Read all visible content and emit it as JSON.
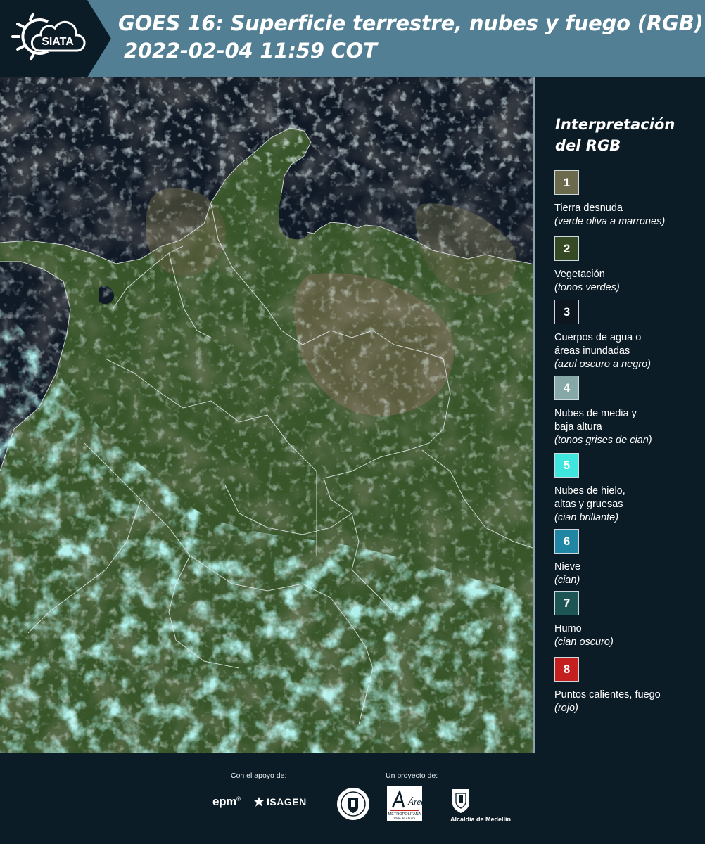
{
  "header": {
    "logo_text": "SIATA",
    "title_line1": "GOES 16: Superficie terrestre, nubes y fuego (RGB)",
    "title_line2": "2022-02-04 11:59 COT"
  },
  "legend": {
    "title_line1": "Interpretación",
    "title_line2": "del RGB",
    "items": [
      {
        "number": "1",
        "color": "#6b6a4c",
        "label_lines": [
          "Tierra desnuda"
        ],
        "note": "(verde oliva a marrones)"
      },
      {
        "number": "2",
        "color": "#354a24",
        "label_lines": [
          "Vegetación"
        ],
        "note": "(tonos verdes)"
      },
      {
        "number": "3",
        "color": "#0e1720",
        "label_lines": [
          "Cuerpos de agua o",
          "áreas inundadas"
        ],
        "note": "(azul oscuro a negro)"
      },
      {
        "number": "4",
        "color": "#86a9a8",
        "label_lines": [
          "Nubes de media y",
          "baja altura"
        ],
        "note": "(tonos grises de cian)"
      },
      {
        "number": "5",
        "color": "#3ee6de",
        "label_lines": [
          "Nubes de hielo,",
          "altas y gruesas"
        ],
        "note": "(cian brillante)"
      },
      {
        "number": "6",
        "color": "#2186a3",
        "label_lines": [
          "Nieve"
        ],
        "note": "(cian)"
      },
      {
        "number": "7",
        "color": "#1d5554",
        "label_lines": [
          "Humo"
        ],
        "note": "(cian oscuro)"
      },
      {
        "number": "8",
        "color": "#c42020",
        "label_lines": [
          "Puntos calientes, fuego"
        ],
        "note": "(rojo)"
      }
    ]
  },
  "footer": {
    "support_label": "Con el apoyo de:",
    "project_label": "Un proyecto de:",
    "epm_text": "epm",
    "isagen_text": "ISAGEN",
    "area_text_1": "Área",
    "area_text_2": "METROPOLITANA",
    "area_text_3": "Valle de Aburrá",
    "alcaldia_text": "Alcaldía de Medellín"
  }
}
